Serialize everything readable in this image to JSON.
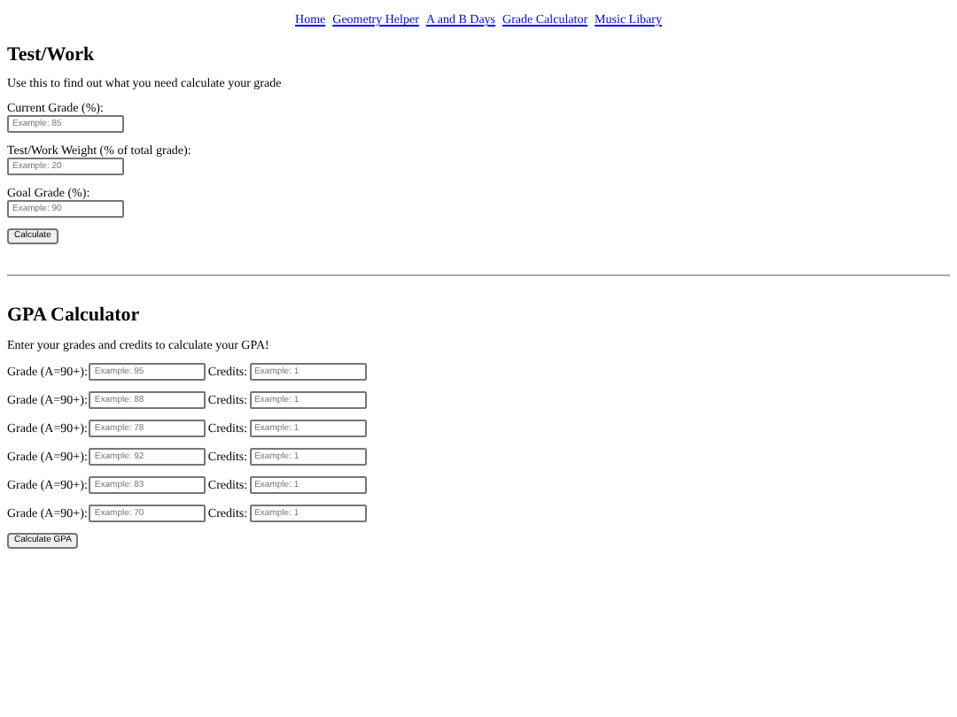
{
  "nav": [
    "Home",
    "Geometry Helper",
    "A and B Days",
    "Grade Calculator",
    "Music Libary"
  ],
  "test_work": {
    "title": "Test/Work",
    "description": "Use this to find out what you need calculate your grade",
    "fields": [
      {
        "label": "Current Grade (%):",
        "placeholder": "Example: 85"
      },
      {
        "label": "Test/Work Weight (% of total grade):",
        "placeholder": "Example: 20"
      },
      {
        "label": "Goal Grade (%):",
        "placeholder": "Example: 90"
      }
    ],
    "button": "Calculate"
  },
  "gpa": {
    "title": "GPA Calculator",
    "description": "Enter your grades and credits to calculate your GPA!",
    "rows": [
      {
        "grade_label": "Grade (A=90+):",
        "grade_placeholder": "Example: 95",
        "credits_label": "Credits:",
        "credits_placeholder": "Example: 1"
      },
      {
        "grade_label": "Grade (A=90+):",
        "grade_placeholder": "Example: 88",
        "credits_label": "Credits:",
        "credits_placeholder": "Example: 1"
      },
      {
        "grade_label": "Grade (A=90+):",
        "grade_placeholder": "Example: 78",
        "credits_label": "Credits:",
        "credits_placeholder": "Example: 1"
      },
      {
        "grade_label": "Grade (A=90+):",
        "grade_placeholder": "Example: 92",
        "credits_label": "Credits:",
        "credits_placeholder": "Example: 1"
      },
      {
        "grade_label": "Grade (A=90+):",
        "grade_placeholder": "Example: 83",
        "credits_label": "Credits:",
        "credits_placeholder": "Example: 1"
      },
      {
        "grade_label": "Grade (A=90+):",
        "grade_placeholder": "Example: 70",
        "credits_label": "Credits:",
        "credits_placeholder": "Example: 1"
      }
    ],
    "button": "Calculate GPA"
  }
}
